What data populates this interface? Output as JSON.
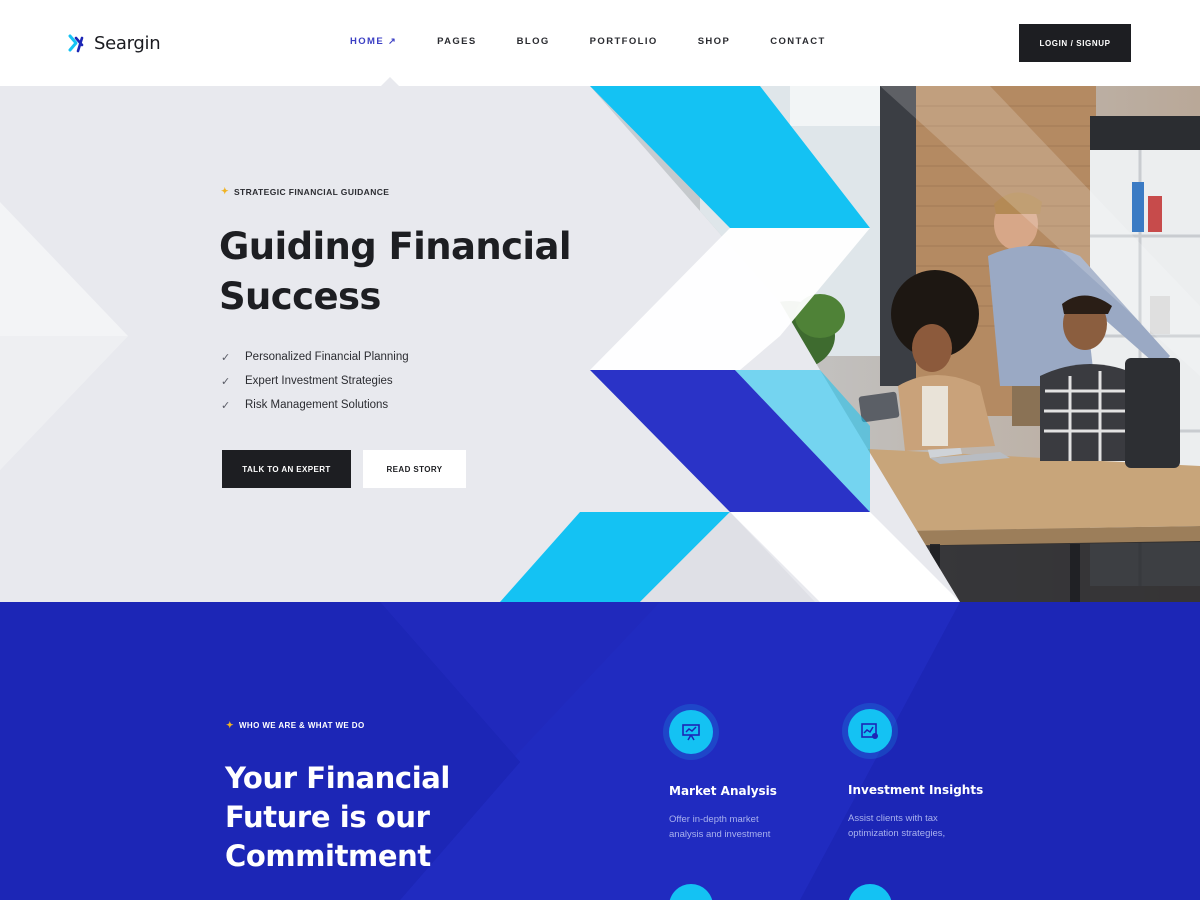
{
  "header": {
    "logo_text": "Seargin",
    "nav": [
      {
        "label": "HOME",
        "active": true,
        "icon": "arrow-up-right-icon"
      },
      {
        "label": "PAGES"
      },
      {
        "label": "BLOG"
      },
      {
        "label": "PORTFOLIO"
      },
      {
        "label": "SHOP"
      },
      {
        "label": "CONTACT"
      }
    ],
    "login_label": "LOGIN / SIGNUP"
  },
  "hero": {
    "eyebrow": "STRATEGIC FINANCIAL GUIDANCE",
    "title_line1": "Guiding Financial",
    "title_line2": "Success",
    "checklist": [
      "Personalized Financial Planning",
      "Expert Investment Strategies",
      "Risk Management Solutions"
    ],
    "primary_button": "TALK TO AN EXPERT",
    "secondary_button": "READ STORY"
  },
  "about": {
    "eyebrow": "WHO WE ARE & WHAT WE DO",
    "title_line1": "Your Financial",
    "title_line2": "Future is our",
    "title_line3": "Commitment",
    "features": [
      {
        "title": "Market Analysis",
        "text_line1": "Offer in-depth market",
        "text_line2": "analysis and investment",
        "icon": "presentation-chart-icon"
      },
      {
        "title": "Investment Insights",
        "text_line1": "Assist clients with tax",
        "text_line2": "optimization strategies,",
        "icon": "chart-gear-icon"
      }
    ]
  },
  "colors": {
    "brand_blue": "#1c26b6",
    "accent_cyan": "#14c2f3",
    "dark": "#1d1e22",
    "hero_bg": "#e8e9ee",
    "nav_active": "#3b3fc4"
  }
}
